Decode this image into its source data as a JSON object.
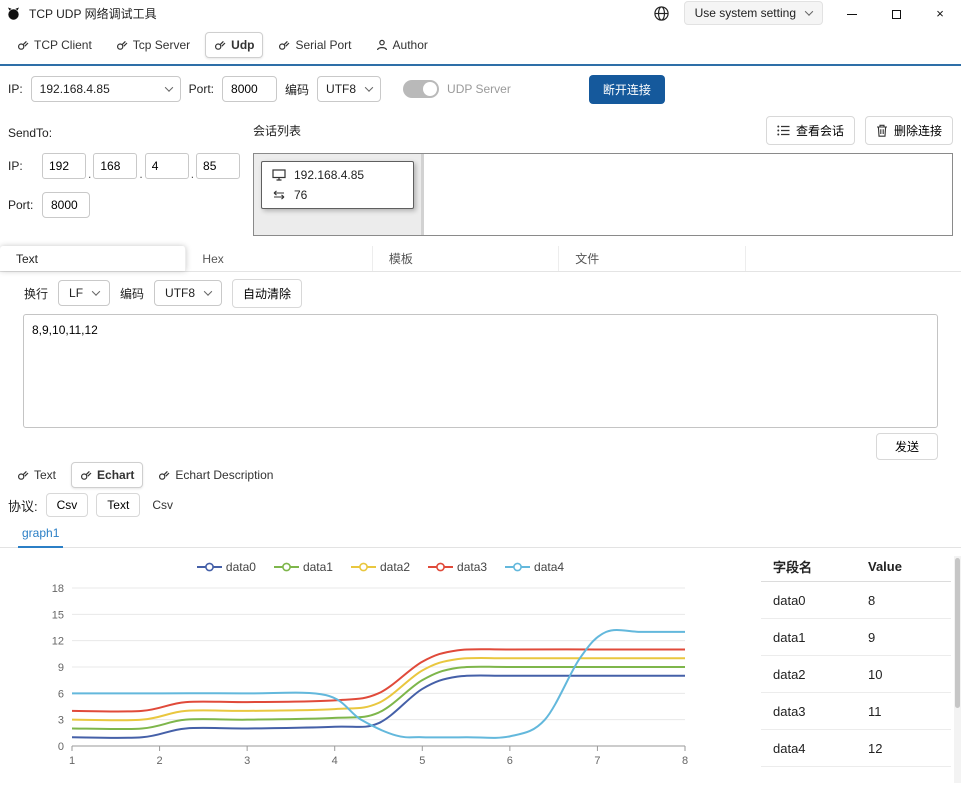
{
  "window": {
    "title": "TCP UDP 网络调试工具",
    "language_select": "Use system setting"
  },
  "tabs": [
    {
      "label": "TCP Client"
    },
    {
      "label": "Tcp Server"
    },
    {
      "label": "Udp",
      "selected": true
    },
    {
      "label": "Serial Port"
    },
    {
      "label": "Author"
    }
  ],
  "connection": {
    "ip_label": "IP:",
    "ip": "192.168.4.85",
    "port_label": "Port:",
    "port": "8000",
    "encoding_label": "编码",
    "encoding": "UTF8",
    "udp_server_label": "UDP Server",
    "disconnect_label": "断开连接"
  },
  "sendto": {
    "title": "SendTo:",
    "ip_label": "IP:",
    "ip_parts": [
      "192",
      "168",
      "4",
      "85"
    ],
    "port_label": "Port:",
    "port": "8000"
  },
  "session": {
    "title": "会话列表",
    "view_button": "查看会话",
    "delete_button": "删除连接",
    "card": {
      "ip": "192.168.4.85",
      "count": "76"
    }
  },
  "send_tabs": [
    "Text",
    "Hex",
    "模板",
    "文件"
  ],
  "send_controls": {
    "linebreak_label": "换行",
    "linebreak": "LF",
    "encoding_label": "编码",
    "encoding": "UTF8",
    "autoclear_label": "自动清除",
    "send_label": "发送"
  },
  "send_text": "8,9,10,11,12",
  "view_tabs": [
    {
      "label": "Text"
    },
    {
      "label": "Echart",
      "selected": true
    },
    {
      "label": "Echart Description"
    }
  ],
  "protocol": {
    "label": "协议:",
    "options": [
      "Csv",
      "Text",
      "Csv"
    ]
  },
  "graph_tab": "graph1",
  "chart_data": {
    "type": "line",
    "title": "",
    "xlabel": "",
    "ylabel": "",
    "x_range": [
      1,
      8
    ],
    "x_ticks": [
      1,
      2,
      3,
      4,
      5,
      6,
      7,
      8
    ],
    "y_ticks": [
      0,
      3,
      6,
      9,
      12,
      15,
      18
    ],
    "ylim": [
      0,
      18
    ],
    "grid": true,
    "legend_position": "top",
    "series": [
      {
        "name": "data0",
        "color": "#4560a8",
        "points": [
          [
            1,
            1
          ],
          [
            1.8,
            1
          ],
          [
            2.3,
            2
          ],
          [
            3,
            2
          ],
          [
            4,
            2.2
          ],
          [
            4.5,
            2.6
          ],
          [
            5,
            6.5
          ],
          [
            5.4,
            7.9
          ],
          [
            6,
            8
          ],
          [
            7,
            8
          ],
          [
            8,
            8
          ]
        ]
      },
      {
        "name": "data1",
        "color": "#7eb64b",
        "points": [
          [
            1,
            2
          ],
          [
            1.8,
            2
          ],
          [
            2.3,
            3
          ],
          [
            3,
            3
          ],
          [
            4,
            3.2
          ],
          [
            4.5,
            3.8
          ],
          [
            5,
            7.5
          ],
          [
            5.4,
            8.9
          ],
          [
            6,
            9
          ],
          [
            7,
            9
          ],
          [
            8,
            9
          ]
        ]
      },
      {
        "name": "data2",
        "color": "#e9c73f",
        "points": [
          [
            1,
            3
          ],
          [
            1.8,
            3
          ],
          [
            2.3,
            4
          ],
          [
            3,
            4
          ],
          [
            4,
            4.2
          ],
          [
            4.5,
            4.9
          ],
          [
            5,
            8.6
          ],
          [
            5.4,
            9.9
          ],
          [
            6,
            10
          ],
          [
            7,
            10
          ],
          [
            8,
            10
          ]
        ]
      },
      {
        "name": "data3",
        "color": "#e04a3a",
        "points": [
          [
            1,
            4
          ],
          [
            1.8,
            4
          ],
          [
            2.3,
            5
          ],
          [
            3,
            5
          ],
          [
            4,
            5.2
          ],
          [
            4.5,
            6
          ],
          [
            5,
            9.6
          ],
          [
            5.4,
            10.9
          ],
          [
            6,
            11
          ],
          [
            7,
            11
          ],
          [
            8,
            11
          ]
        ]
      },
      {
        "name": "data4",
        "color": "#63b8dc",
        "points": [
          [
            1,
            6
          ],
          [
            2,
            6
          ],
          [
            3,
            6
          ],
          [
            3.9,
            5.8
          ],
          [
            4.3,
            3
          ],
          [
            4.7,
            1.2
          ],
          [
            5,
            1
          ],
          [
            5.5,
            1
          ],
          [
            6,
            1.1
          ],
          [
            6.4,
            3
          ],
          [
            6.8,
            10
          ],
          [
            7.1,
            13
          ],
          [
            7.5,
            13
          ],
          [
            8,
            13
          ]
        ]
      }
    ]
  },
  "table": {
    "headers": [
      "字段名",
      "Value"
    ],
    "rows": [
      [
        "data0",
        "8"
      ],
      [
        "data1",
        "9"
      ],
      [
        "data2",
        "10"
      ],
      [
        "data3",
        "11"
      ],
      [
        "data4",
        "12"
      ]
    ]
  },
  "colors": {
    "accent": "#15599c",
    "tab_underline": "#2e6fa8",
    "graph_tab": "#2b7fc6"
  }
}
